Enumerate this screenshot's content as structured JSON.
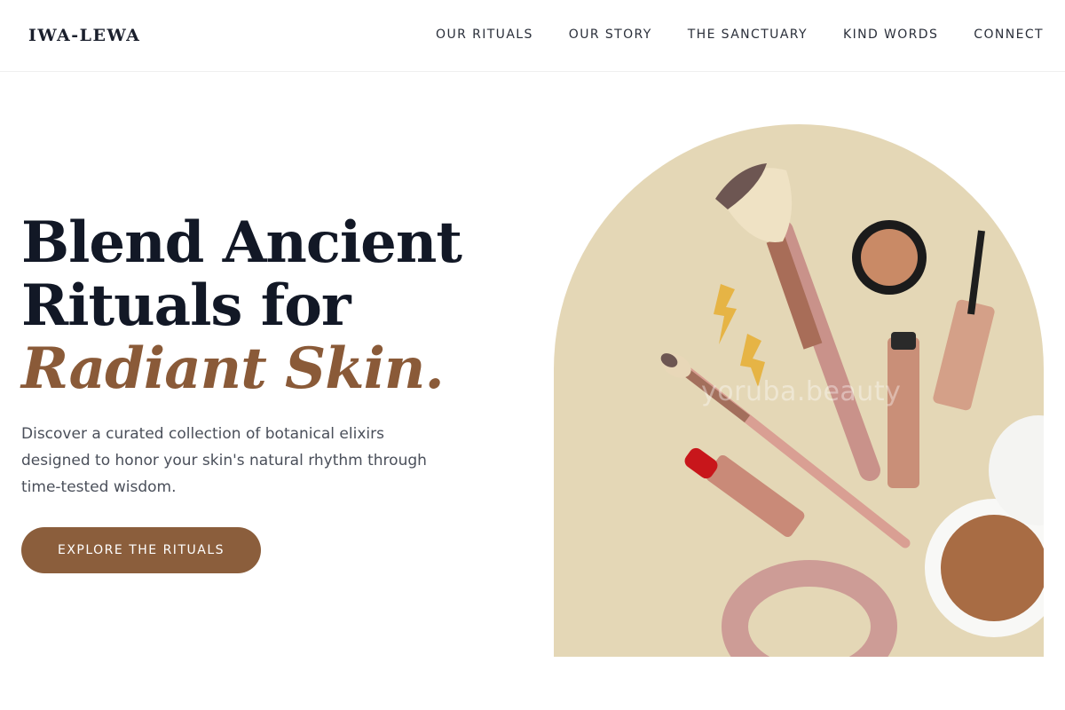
{
  "header": {
    "logo": "IWA-LEWA",
    "nav": [
      "OUR RITUALS",
      "OUR STORY",
      "THE SANCTUARY",
      "KIND WORDS",
      "CONNECT"
    ]
  },
  "hero": {
    "title_line1": "Blend Ancient",
    "title_line2": "Rituals for",
    "title_line3": "Radiant Skin.",
    "description": "Discover a curated collection of botanical elixirs designed to honor your skin's natural rhythm through time-tested wisdom.",
    "cta_label": "EXPLORE THE RITUALS",
    "image_watermark": "yoruba.beauty"
  },
  "colors": {
    "accent": "#8b5e3c",
    "heading": "#121826",
    "arch_background": "#e4d7b6"
  }
}
